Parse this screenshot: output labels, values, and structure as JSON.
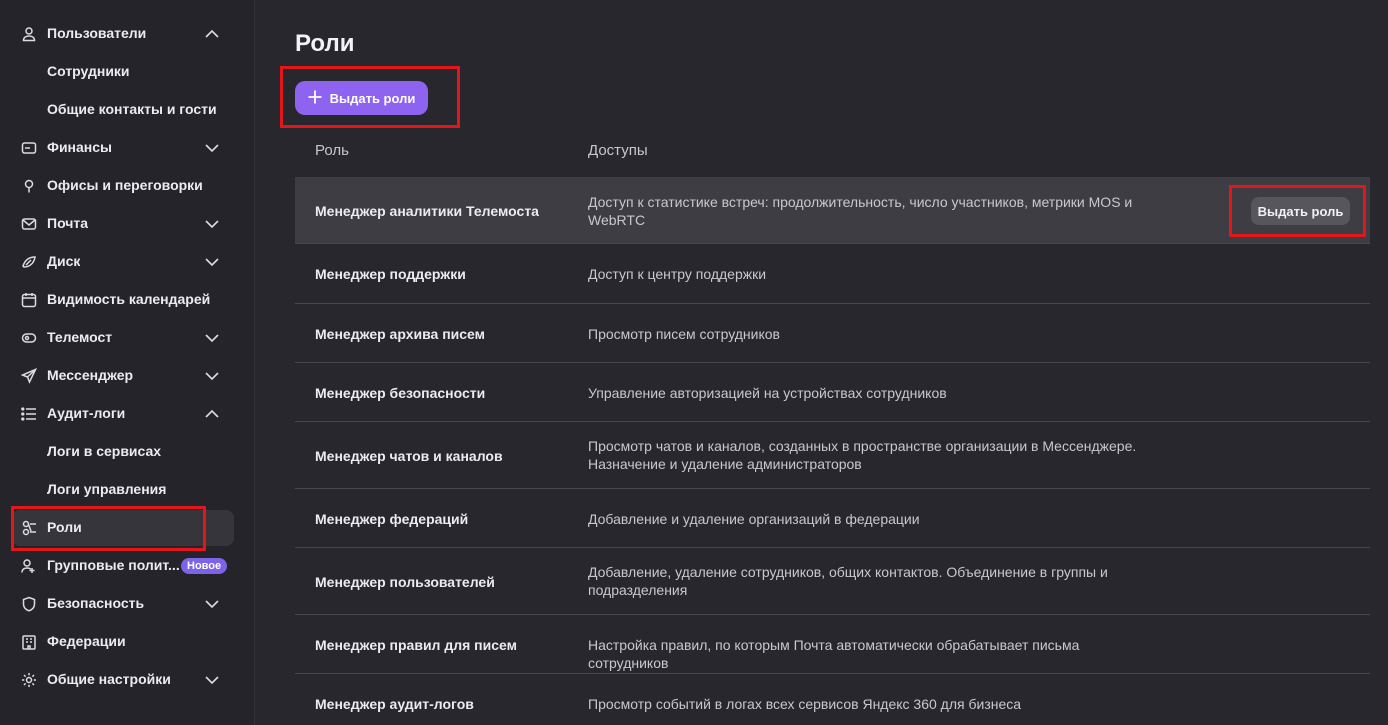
{
  "sidebar": {
    "items": [
      {
        "label": "Пользователи",
        "icon": "user-icon",
        "chevron": "up"
      },
      {
        "label": "Сотрудники"
      },
      {
        "label": "Общие контакты и гости"
      },
      {
        "label": "Финансы",
        "icon": "wallet-icon",
        "chevron": "down"
      },
      {
        "label": "Офисы и переговорки",
        "icon": "location-pin-icon"
      },
      {
        "label": "Почта",
        "icon": "mail-icon",
        "chevron": "down"
      },
      {
        "label": "Диск",
        "icon": "disk-icon",
        "chevron": "down"
      },
      {
        "label": "Видимость календарей",
        "icon": "calendar-icon"
      },
      {
        "label": "Телемост",
        "icon": "telemost-icon",
        "chevron": "down"
      },
      {
        "label": "Мессенджер",
        "icon": "send-icon",
        "chevron": "down"
      },
      {
        "label": "Аудит-логи",
        "icon": "list-icon",
        "chevron": "up"
      },
      {
        "label": "Логи в сервисах"
      },
      {
        "label": "Логи управления"
      },
      {
        "label": "Роли",
        "icon": "roles-icon",
        "active": true
      },
      {
        "label": "Групповые полит...",
        "icon": "group-policy-icon",
        "badge": "Новое"
      },
      {
        "label": "Безопасность",
        "icon": "shield-icon",
        "chevron": "down"
      },
      {
        "label": "Федерации",
        "icon": "federation-icon"
      },
      {
        "label": "Общие настройки",
        "icon": "gear-icon",
        "chevron": "down"
      }
    ]
  },
  "main": {
    "title": "Роли",
    "grant_roles_label": "Выдать роли",
    "table": {
      "headers": {
        "role": "Роль",
        "access": "Доступы"
      },
      "row_action_label": "Выдать роль",
      "rows": [
        {
          "role": "Менеджер аналитики Телемоста",
          "access": "Доступ к статистике встреч: продолжительность, число участников, метрики MOS и WebRTC"
        },
        {
          "role": "Менеджер поддержки",
          "access": "Доступ к центру поддержки"
        },
        {
          "role": "Менеджер архива писем",
          "access": "Просмотр писем сотрудников"
        },
        {
          "role": "Менеджер безопасности",
          "access": "Управление авторизацией на устройствах сотрудников"
        },
        {
          "role": "Менеджер чатов и каналов",
          "access": "Просмотр чатов и каналов, созданных в пространстве организации в Мессенджере. Назначение и удаление администраторов"
        },
        {
          "role": "Менеджер федераций",
          "access": "Добавление и удаление организаций в федерации"
        },
        {
          "role": "Менеджер пользователей",
          "access": "Добавление, удаление сотрудников, общих контактов. Объединение в группы и подразделения"
        },
        {
          "role": "Менеджер правил для писем",
          "access": "Настройка правил, по которым Почта автоматически обрабатывает письма сотрудников"
        },
        {
          "role": "Менеджер аудит-логов",
          "access": "Просмотр событий в логах всех сервисов Яндекс 360 для бизнеса"
        }
      ]
    }
  },
  "colors": {
    "accent": "#8e63f0",
    "highlight": "#e5161b",
    "badge": "#7c63e8"
  }
}
